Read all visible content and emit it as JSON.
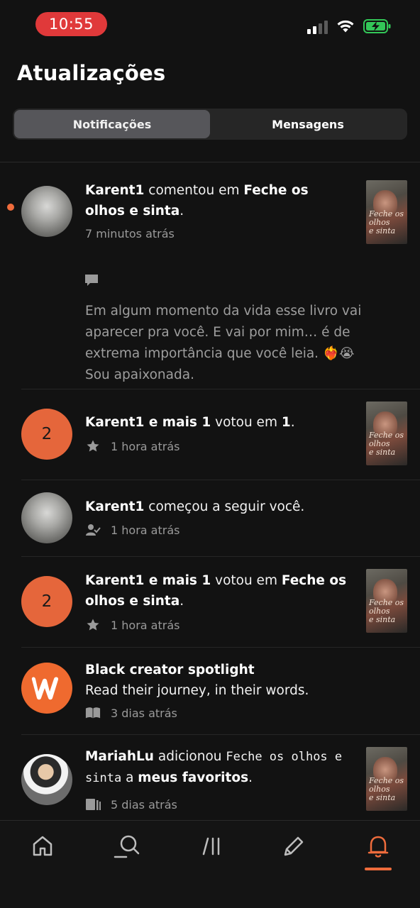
{
  "status_bar": {
    "time": "10:55"
  },
  "header": {
    "title": "Atualizações"
  },
  "tabs": [
    {
      "label": "Notificações",
      "active": true
    },
    {
      "label": "Mensagens",
      "active": false
    }
  ],
  "notifications": [
    {
      "user": "Karent1",
      "action": " comentou em ",
      "target": "Feche os olhos e sinta",
      "suffix": ".",
      "time": "7 minutos atrás",
      "comment": "Em algum momento da vida esse livro vai aparecer pra você. E vai por mim… é de extrema importância que você leia. ❤️‍🔥😭 Sou apaixonada.",
      "unread": true
    },
    {
      "avatar_count": "2",
      "user": "Karent1 e mais 1",
      "action": " votou em ",
      "target": "1",
      "suffix": ".",
      "time": "1 hora atrás"
    },
    {
      "user": "Karent1",
      "action": " começou a seguir você.",
      "time": "1 hora atrás"
    },
    {
      "avatar_count": "2",
      "user": "Karent1 e mais 1",
      "action": " votou em ",
      "target": "Feche os olhos e sinta",
      "suffix": ".",
      "time": "1 hora atrás"
    },
    {
      "title": "Black creator spotlight",
      "body": "Read their journey, in their words.",
      "time": "3 dias atrás"
    },
    {
      "user": "MariahLu",
      "action": " adicionou ",
      "story": "Feche os olhos e sinta",
      "mid": " a ",
      "target": "meus favoritos",
      "suffix": ".",
      "time": "5 dias atrás"
    }
  ],
  "cover": {
    "line1": "Feche os",
    "line2": "olhos",
    "line3": "e sinta"
  },
  "tab_bar": [
    "home-icon",
    "search-icon",
    "library-icon",
    "write-icon",
    "notifications-icon"
  ],
  "colors": {
    "accent": "#ef6c3c",
    "time_pill": "#e0393a",
    "count_avatar": "#e5663b"
  }
}
